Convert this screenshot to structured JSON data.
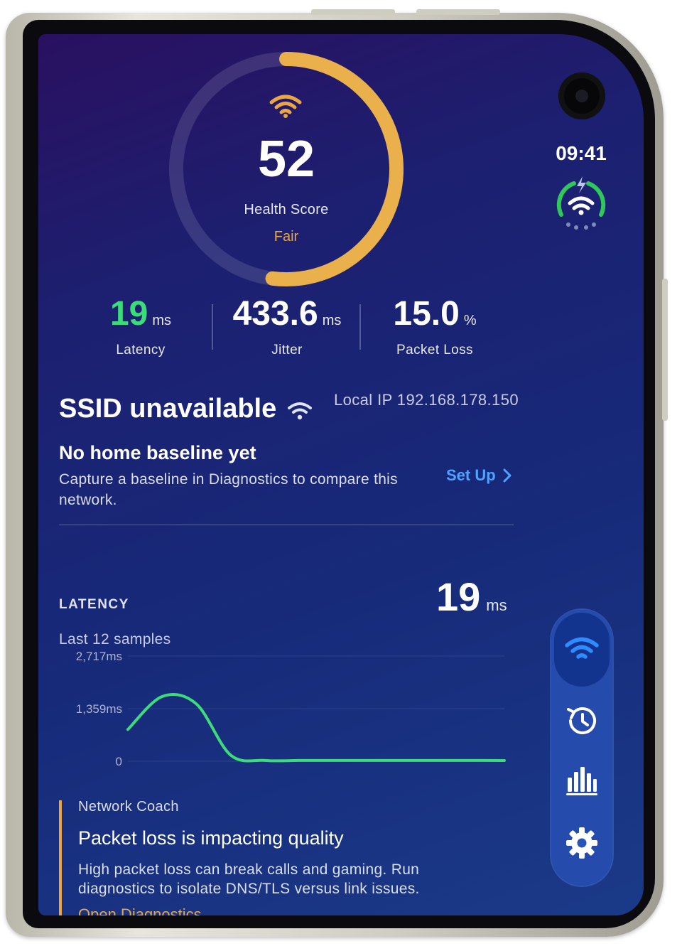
{
  "status_bar": {
    "time": "09:41"
  },
  "health": {
    "score": "52",
    "score_fraction": 0.52,
    "label": "Health Score",
    "status": "Fair",
    "wifi_icon": "wifi-icon",
    "accent_color": "#e9a645"
  },
  "metrics": [
    {
      "value": "19",
      "unit": "ms",
      "label": "Latency",
      "color": "#3ddc7a"
    },
    {
      "value": "433.6",
      "unit": "ms",
      "label": "Jitter",
      "color": "#ffffff"
    },
    {
      "value": "15.0",
      "unit": "%",
      "label": "Packet Loss",
      "color": "#ffffff"
    }
  ],
  "network": {
    "ssid": "SSID unavailable",
    "local_ip": "Local IP 192.168.178.150",
    "baseline_title": "No home baseline yet",
    "baseline_desc": "Capture a baseline in Diagnostics to compare this network.",
    "setup_label": "Set Up"
  },
  "latency": {
    "title": "LATENCY",
    "value": "19",
    "unit": "ms",
    "samples_label": "Last 12 samples"
  },
  "chart_data": {
    "type": "line",
    "title": "",
    "ylabel": "",
    "yticks": [
      "2,717ms",
      "1,359ms",
      "0"
    ],
    "ylim": [
      0,
      2717
    ],
    "x": [
      1,
      2,
      3,
      4,
      5,
      6,
      7,
      8,
      9,
      10,
      11,
      12
    ],
    "series": [
      {
        "values": [
          820,
          1670,
          1480,
          160,
          20,
          20,
          20,
          20,
          20,
          20,
          20,
          19
        ],
        "color": "#3ddc7a"
      }
    ]
  },
  "coach": {
    "label": "Network Coach",
    "title": "Packet loss is impacting quality",
    "desc": "High packet loss can break calls and gaming. Run diagnostics to isolate DNS/TLS versus link issues.",
    "action": "Open Diagnostics"
  },
  "nav": [
    {
      "icon": "wifi-icon",
      "active": true
    },
    {
      "icon": "history-icon",
      "active": false
    },
    {
      "icon": "bar-chart-icon",
      "active": false
    },
    {
      "icon": "gear-icon",
      "active": false
    }
  ]
}
